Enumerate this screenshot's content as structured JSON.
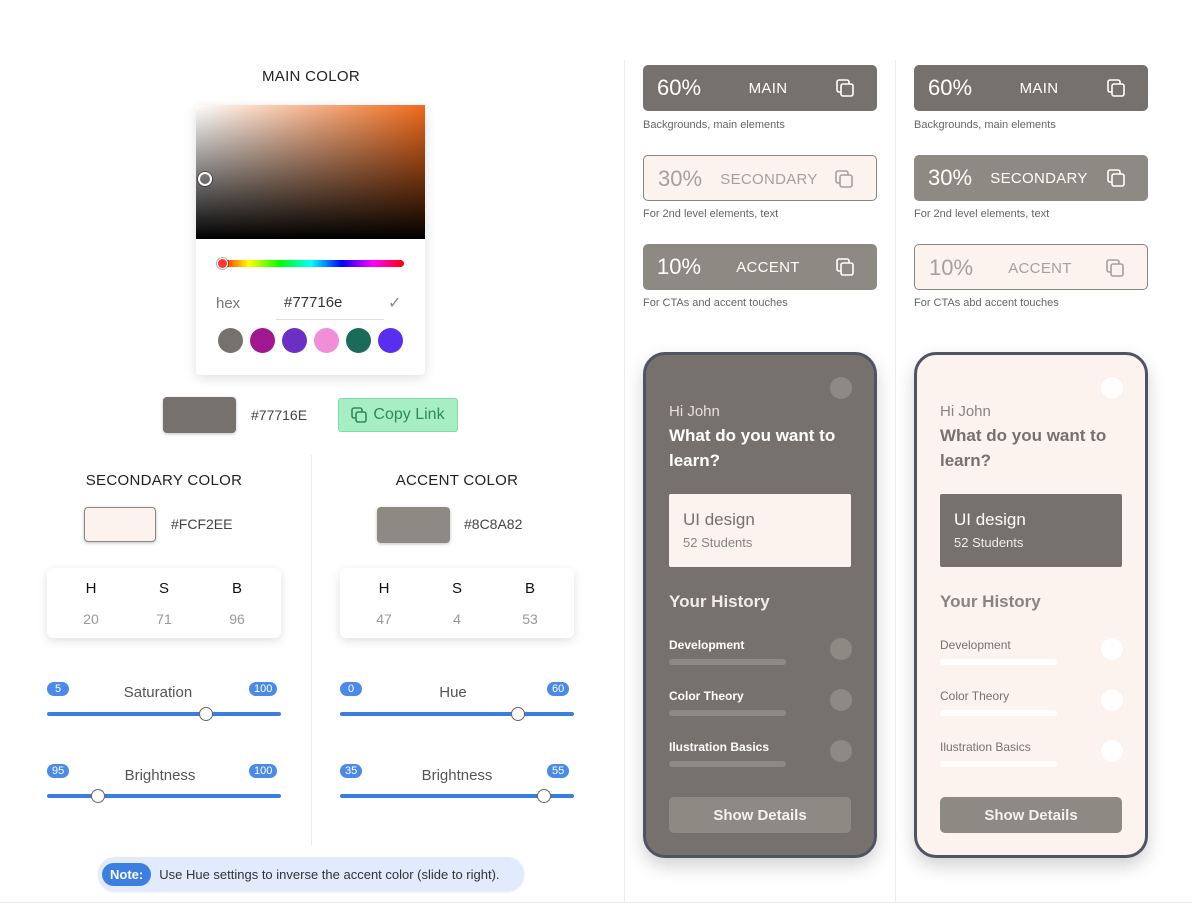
{
  "colors": {
    "main": "#77716e",
    "secondary": "#FCF2EE",
    "accent": "#8C8A82",
    "copy_green": "#a8eec5",
    "slider_blue": "#3a7fe0"
  },
  "main_color": {
    "title": "MAIN COLOR",
    "hex_label": "hex",
    "hex_value": "#77716e",
    "hex_display": "#77716E",
    "swatches": [
      "#77716e",
      "#a0178f",
      "#6b2fc4",
      "#f08fd8",
      "#1a6b5a",
      "#5a2ef0"
    ],
    "copy_link_label": "Copy Link"
  },
  "secondary_color": {
    "title": "SECONDARY COLOR",
    "hex": "#FCF2EE",
    "hsb_labels": [
      "H",
      "S",
      "B"
    ],
    "hsb_values": [
      "20",
      "71",
      "96"
    ],
    "saturation": {
      "label": "Saturation",
      "min": "5",
      "max": "100",
      "value_fraction": 0.68
    },
    "brightness": {
      "label": "Brightness",
      "min": "95",
      "max": "100",
      "value_fraction": 0.22
    }
  },
  "accent_color": {
    "title": "ACCENT COLOR",
    "hex": "#8C8A82",
    "hsb_labels": [
      "H",
      "S",
      "B"
    ],
    "hsb_values": [
      "47",
      "4",
      "53"
    ],
    "hue": {
      "label": "Hue",
      "min": "0",
      "max": "60",
      "value_fraction": 0.76
    },
    "brightness": {
      "label": "Brightness",
      "min": "35",
      "max": "55",
      "value_fraction": 0.87
    }
  },
  "note": {
    "badge": "Note:",
    "text": "Use Hue settings to inverse the accent color (slide to right)."
  },
  "preview_left": {
    "roles": [
      {
        "pct": "60%",
        "name": "MAIN",
        "desc": "Backgrounds, main elements"
      },
      {
        "pct": "30%",
        "name": "SECONDARY",
        "desc": "For 2nd level elements, text"
      },
      {
        "pct": "10%",
        "name": "ACCENT",
        "desc": "For CTAs and accent touches"
      }
    ],
    "phone": {
      "greeting": "Hi John",
      "question": "What do you want to learn?",
      "course_name": "UI design",
      "course_students": "52 Students",
      "history_title": "Your History",
      "items": [
        "Development",
        "Color Theory",
        "Ilustration Basics"
      ],
      "button": "Show Details"
    }
  },
  "preview_right": {
    "roles": [
      {
        "pct": "60%",
        "name": "MAIN",
        "desc": "Backgrounds, main elements"
      },
      {
        "pct": "30%",
        "name": "SECONDARY",
        "desc": "For 2nd level elements, text"
      },
      {
        "pct": "10%",
        "name": "ACCENT",
        "desc": "For CTAs abd accent touches"
      }
    ],
    "phone": {
      "greeting": "Hi John",
      "question": "What do you want to learn?",
      "course_name": "UI design",
      "course_students": "52 Students",
      "history_title": "Your History",
      "items": [
        "Development",
        "Color Theory",
        "Ilustration Basics"
      ],
      "button": "Show Details"
    }
  }
}
